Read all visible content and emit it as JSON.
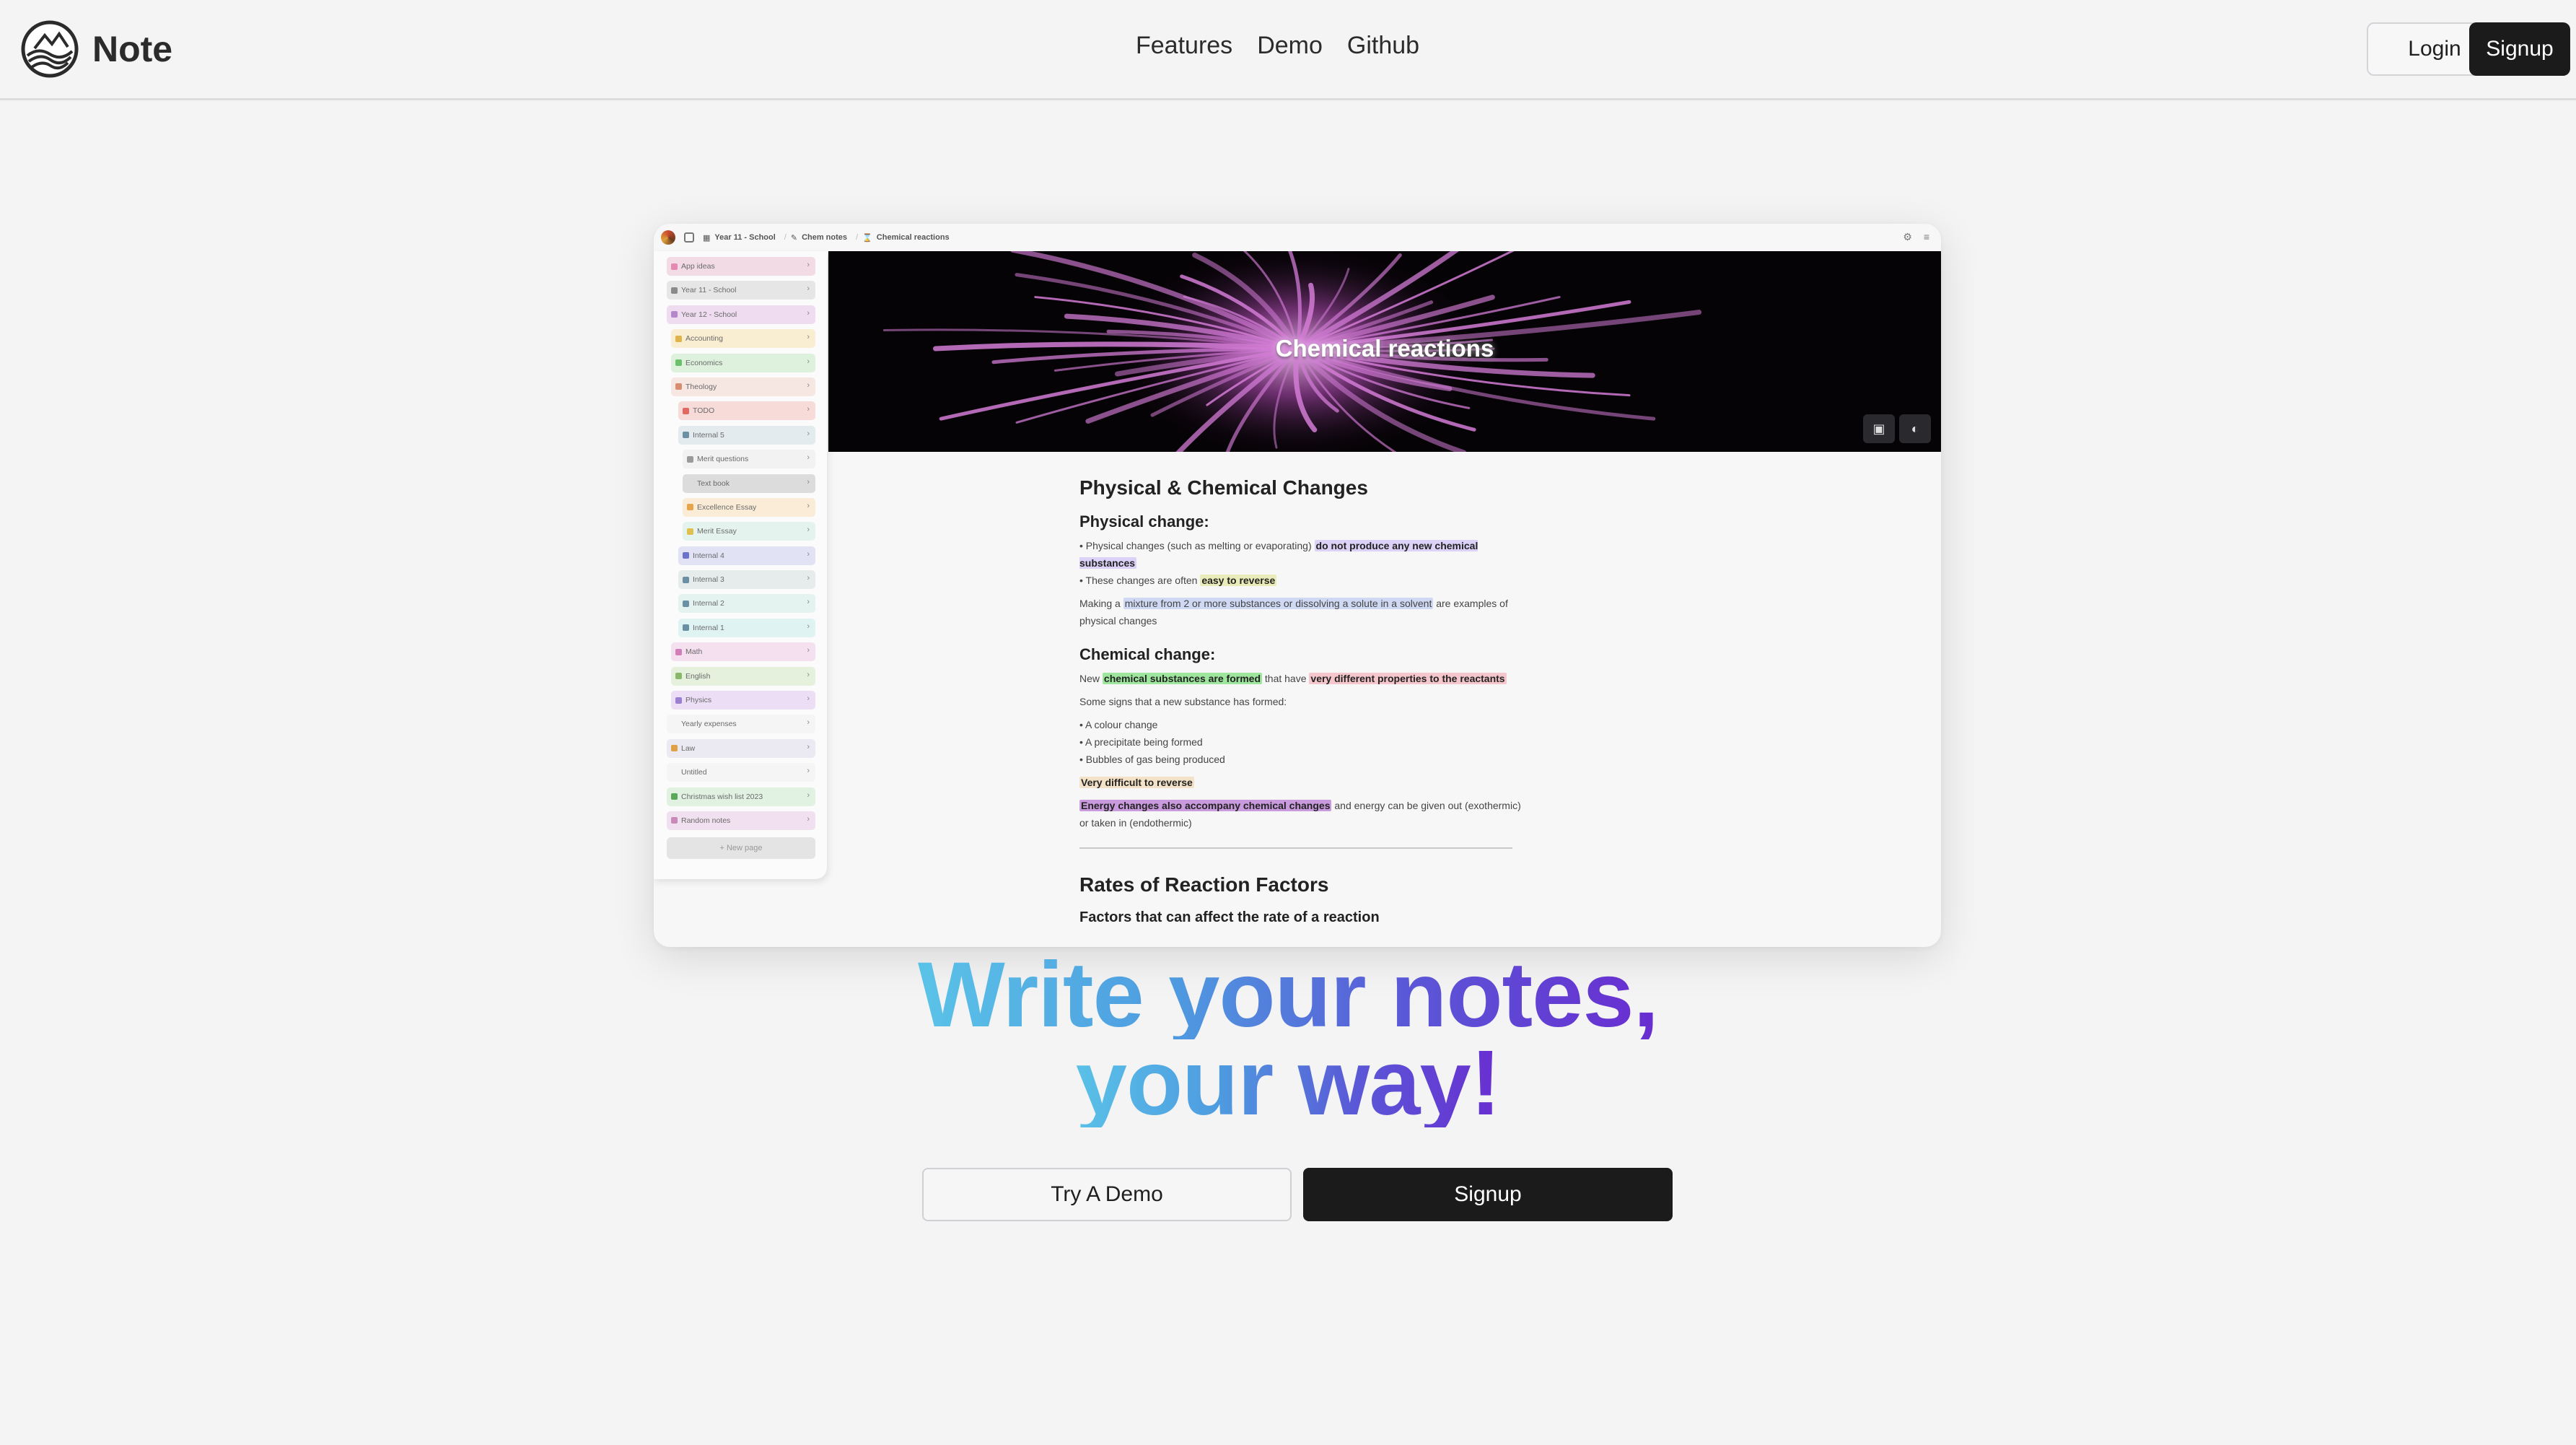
{
  "brand": {
    "name": "Note",
    "logo_icon": "wave-globe-icon"
  },
  "nav": [
    "Features",
    "Demo",
    "Github"
  ],
  "header_buttons": {
    "login": "Login",
    "signup": "Signup"
  },
  "preview": {
    "breadcrumbs": [
      "Year 11 - School",
      "Chem notes",
      "Chemical reactions"
    ],
    "topbar_icons": [
      "settings-icon",
      "menu-icon"
    ],
    "sidebar": {
      "items": [
        {
          "label": "App ideas",
          "color": "#f3dbe6",
          "dot": "#e58ab0"
        },
        {
          "label": "Year 11 - School",
          "color": "#e6e6e6",
          "dot": "#8a8a8a"
        },
        {
          "label": "Year 12 - School",
          "color": "#efdcf0",
          "dot": "#b387c9"
        },
        {
          "label": "Accounting",
          "color": "#faeed2",
          "dot": "#e0b24a"
        },
        {
          "label": "Economics",
          "color": "#ddf1dd",
          "dot": "#6cc06c"
        },
        {
          "label": "Theology",
          "color": "#f6e7e2",
          "dot": "#d88d6e"
        },
        {
          "label": "TODO",
          "color": "#f7dbd9",
          "dot": "#e06a61"
        },
        {
          "label": "Internal 5",
          "color": "#e3ebee",
          "dot": "#6b8fa3"
        },
        {
          "label": "Merit questions",
          "color": "#f2f2f2",
          "dot": "#9a9a9a"
        },
        {
          "label": "Text book",
          "color": "#dcdcdc",
          "dot": "#dcdcdc"
        },
        {
          "label": "Excellence Essay",
          "color": "#faecd6",
          "dot": "#e7a44a"
        },
        {
          "label": "Merit Essay",
          "color": "#e5f3ee",
          "dot": "#e0c04c"
        },
        {
          "label": "Internal 4",
          "color": "#e2e2f5",
          "dot": "#6d73c9"
        },
        {
          "label": "Internal 3",
          "color": "#e6ecec",
          "dot": "#6b8fa3"
        },
        {
          "label": "Internal 2",
          "color": "#e4f2f0",
          "dot": "#6b8fa3"
        },
        {
          "label": "Internal 1",
          "color": "#e0f3f3",
          "dot": "#6b8fa3"
        },
        {
          "label": "Math",
          "color": "#f5e0f0",
          "dot": "#d17fb8"
        },
        {
          "label": "English",
          "color": "#e5f0dd",
          "dot": "#8ab86a"
        },
        {
          "label": "Physics",
          "color": "#ecdff5",
          "dot": "#9b7fd1"
        },
        {
          "label": "Yearly expenses",
          "color": "#f5f5f5",
          "dot": "#f5f5f5"
        },
        {
          "label": "Law",
          "color": "#ebeaf3",
          "dot": "#e0a045"
        },
        {
          "label": "Untitled",
          "color": "#f5f5f5",
          "dot": "#f5f5f5"
        },
        {
          "label": "Christmas wish list 2023",
          "color": "#e2f2e2",
          "dot": "#5aa85a"
        },
        {
          "label": "Random notes",
          "color": "#f1e1f0",
          "dot": "#c98ab8"
        }
      ],
      "new_page": "+ New page"
    },
    "cover": {
      "title": "Chemical reactions",
      "buttons": [
        "image-icon",
        "palette-icon"
      ]
    },
    "document": {
      "heading": "Physical & Chemical Changes",
      "physical": {
        "title": "Physical change:",
        "b1_pre": "• Physical changes (such as melting or evaporating) ",
        "b1_hl": "do not produce any new chemical substances",
        "b2_pre": "• These changes are often ",
        "b2_hl": "easy to reverse",
        "p_pre": "Making a ",
        "p_hl": "mixture from 2 or more substances or dissolving a solute in a solvent",
        "p_post": " are examples of physical changes"
      },
      "chemical": {
        "title": "Chemical change:",
        "p1_pre": "New ",
        "p1_hl1": "chemical substances are formed",
        "p1_mid": " that have ",
        "p1_hl2": "very different properties to the reactants",
        "p2": "Some signs that a new substance has formed:",
        "signs": [
          "• A colour change",
          "• A precipitate being formed",
          "• Bubbles of gas being produced"
        ],
        "hl_reverse": "Very difficult to reverse",
        "p3_hl": "Energy changes also accompany chemical changes",
        "p3_post": " and energy can be given out (exothermic) or taken in (endothermic)"
      },
      "heading2": "Rates of Reaction Factors",
      "subtext": "Factors that can affect the rate of a reaction"
    }
  },
  "hero": {
    "line1": "Write your notes,",
    "line2": "your way!",
    "gradient": [
      "#5bc5e8",
      "#4e9be0",
      "#5a58d7",
      "#6a2ad0"
    ]
  },
  "cta": {
    "demo": "Try A Demo",
    "signup": "Signup"
  }
}
